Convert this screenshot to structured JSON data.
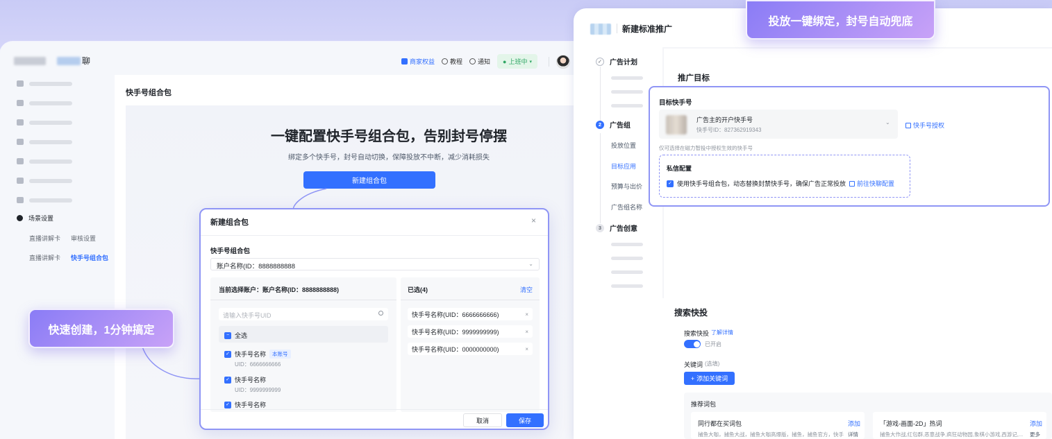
{
  "left": {
    "brand_suffix": "聊",
    "nav": {
      "merchant": "商家权益",
      "tutorial": "教程",
      "notice": "通知",
      "status": "上班中"
    },
    "sidebar": {
      "scene_label": "场景设置",
      "sub_items": [
        "直播讲解卡",
        "审核设置",
        "直播讲解卡",
        "快手号组合包"
      ]
    },
    "page_title": "快手号组合包",
    "hero": {
      "title": "一键配置快手号组合包，告别封号停摆",
      "subtitle": "绑定多个快手号，封号自动切换，保障投放不中断，减少消耗损失",
      "button": "新建组合包"
    },
    "modal": {
      "title": "新建组合包",
      "close": "×",
      "field_label": "快手号组合包",
      "account_value": "账户名称(ID：8888888888",
      "left_pane": {
        "header": "当前选择账户：账户名称(ID：8888888888)",
        "search_placeholder": "请输入快手号UID",
        "select_all": "全选",
        "items": [
          {
            "name": "快手号名称",
            "tag": "本账号",
            "uid": "UID：6666666666"
          },
          {
            "name": "快手号名称",
            "tag": "",
            "uid": "UID：9999999999"
          },
          {
            "name": "快手号名称",
            "tag": "",
            "uid": ""
          }
        ]
      },
      "right_pane": {
        "header": "已选(4)",
        "clear": "清空",
        "items": [
          "快手号名称(UID：6666666666)",
          "快手号名称(UID：9999999999)",
          "快手号名称(UID：0000000000)"
        ]
      },
      "cancel": "取消",
      "save": "保存"
    }
  },
  "bubbles": {
    "left": "快速创建，1分钟搞定",
    "right": "投放一键绑定，封号自动兜底"
  },
  "right": {
    "title": "新建标准推广",
    "steps": [
      {
        "num": "✓",
        "label": "广告计划"
      },
      {
        "num": "2",
        "label": "广告组"
      },
      {
        "num": "3",
        "label": "广告创意"
      }
    ],
    "step2_subs": [
      "投放位置",
      "目标应用",
      "预算与出价",
      "广告组名称"
    ],
    "section_title": "推广目标",
    "target": {
      "label": "目标快手号",
      "account_name": "广告主的开户快手号",
      "account_id": "快手号ID：827362919343",
      "auth_link": "快手号授权",
      "hint": "仅可选择在磁力智投中授权生效的快手号",
      "private_title": "私信配置",
      "private_text": "使用快手号组合包，动态替换封禁快手号，确保广告正常投放",
      "private_link": "前往快聊配置"
    },
    "search": {
      "title": "搜索快投",
      "label": "搜索快投",
      "detail_link": "了解详情",
      "toggle_state": "已开启",
      "kw_label": "关键词",
      "kw_optional": "(选填)",
      "add_kw": "添加关键词",
      "rec_title": "推荐词包",
      "rec_cards": [
        {
          "title": "同行都在买词包",
          "add": "添加",
          "desc": "捕鱼大咖，捕鱼大战，捕鱼大咖高爆版，捕鱼，捕鱼官方，快手...",
          "more": "详情"
        },
        {
          "title": "「游戏-画面-2D」热词",
          "add": "添加",
          "desc": "捕鱼大作战,红包群,恶意战争,疯狂动物园,象棋小游戏,西游记,...",
          "more": "更多"
        }
      ]
    }
  },
  "colors": {
    "accent": "#3370ff",
    "highlight_border": "#8f95f5",
    "status_green": "#2ea664"
  }
}
